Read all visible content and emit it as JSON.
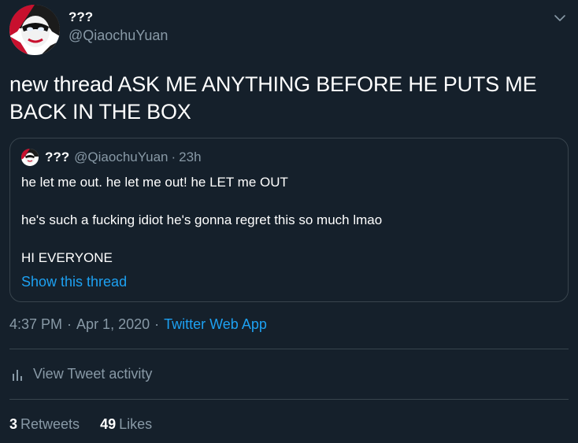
{
  "author": {
    "display_name": "???",
    "handle": "@QiaochuYuan"
  },
  "tweet": {
    "text": "new thread ASK ME ANYTHING BEFORE HE PUTS ME BACK IN THE BOX"
  },
  "quoted_tweet": {
    "display_name": "???",
    "handle": "@QiaochuYuan",
    "separator": "·",
    "time": "23h",
    "lines": [
      "he let me out. he let me out! he LET me OUT",
      "he's such a fucking idiot he's gonna regret this so much lmao",
      "HI EVERYONE"
    ],
    "show_thread": "Show this thread"
  },
  "meta": {
    "time": "4:37 PM",
    "separator": "·",
    "date": "Apr 1, 2020",
    "source": "Twitter Web App"
  },
  "activity": {
    "label": "View Tweet activity",
    "icon": "bar-chart-icon"
  },
  "stats": {
    "retweets_count": "3",
    "retweets_label": "Retweets",
    "likes_count": "49",
    "likes_label": "Likes"
  },
  "colors": {
    "background": "#15202b",
    "text_primary": "#ffffff",
    "text_secondary": "#8899a6",
    "accent": "#1da1f2",
    "border": "#38444d"
  }
}
